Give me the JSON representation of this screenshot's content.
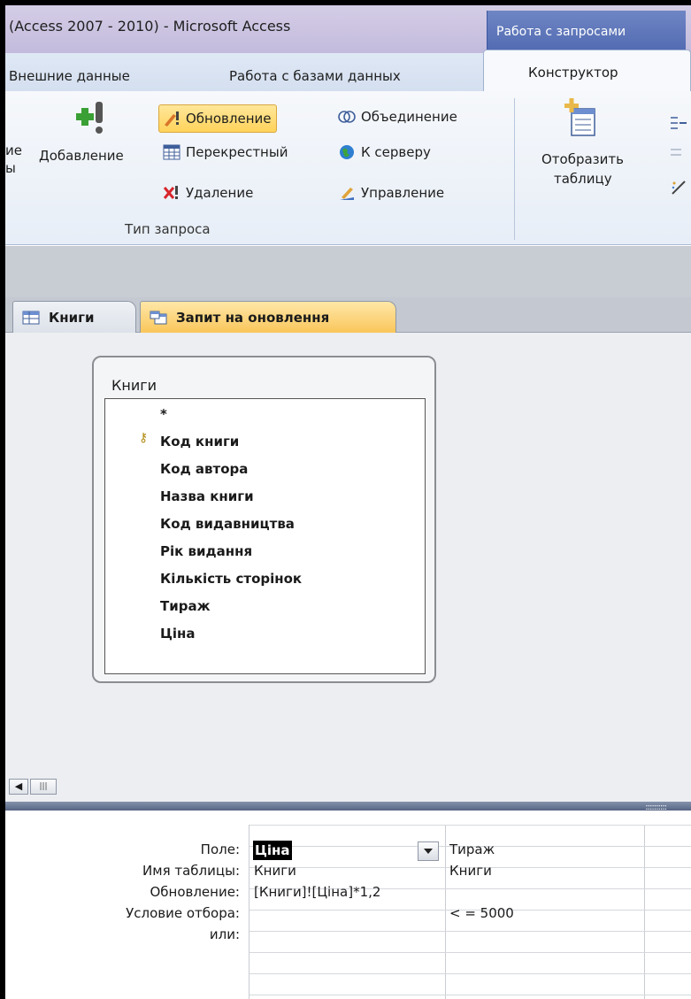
{
  "window": {
    "title": "(Access 2007 - 2010)  -  Microsoft Access",
    "context_tab": "Работа с запросами"
  },
  "ribbon_tabs": [
    "Внешние данные",
    "Работа с базами данных",
    "Конструктор"
  ],
  "ribbon": {
    "left_partial": [
      "ие",
      "ы"
    ],
    "add_button": "Добавление",
    "update_button": "Обновление",
    "crosstab_button": "Перекрестный",
    "delete_button": "Удаление",
    "union_button": "Объединение",
    "passthrough_button": "К серверу",
    "ddl_button": "Управление",
    "group_label": "Тип запроса",
    "show_table_button": [
      "Отобразить",
      "таблицу"
    ]
  },
  "doc_tabs": [
    "Книги",
    "Запит на оновлення"
  ],
  "field_list": {
    "title": "Книги",
    "fields": [
      "*",
      "Код книги",
      "Код автора",
      "Назва книги",
      "Код видавництва",
      "Рік видання",
      "Кількість сторінок",
      "Тираж",
      "Ціна"
    ]
  },
  "grid": {
    "row_labels": [
      "Поле:",
      "Имя таблицы:",
      "Обновление:",
      "Условие отбора:",
      "или:"
    ],
    "columns": [
      {
        "field": "Ціна",
        "table": "Книги",
        "update": "[Книги]![Ціна]*1,2",
        "criteria": ""
      },
      {
        "field": "Тираж",
        "table": "Книги",
        "update": "",
        "criteria": "< = 5000"
      }
    ]
  }
}
